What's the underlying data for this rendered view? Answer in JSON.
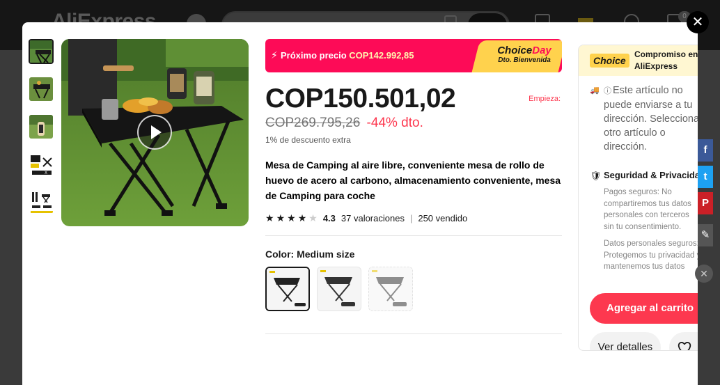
{
  "site": {
    "logo": "AliExpress",
    "cart_count": "0"
  },
  "promo": {
    "label": "Próximo precio",
    "next_price": "COP142.992,85",
    "tag_line1_a": "Choice",
    "tag_line1_b": "Day",
    "tag_line2": "Dto. Bienvenida"
  },
  "price": {
    "current": "COP150.501,02",
    "starts_label": "Empieza:",
    "original": "COP269.795,26",
    "discount": "-44% dto.",
    "extra": "1% de descuento extra"
  },
  "product": {
    "title": "Mesa de Camping al aire libre, conveniente mesa de rollo de huevo de acero al carbono, almacenamiento conveniente, mesa de Camping para coche",
    "rating": "4.3",
    "ratings_count": "37 valoraciones",
    "separator": "|",
    "sold": "250 vendido",
    "stars_value": 4.3
  },
  "color": {
    "label": "Color:",
    "selected": "Medium size",
    "options_count": 3
  },
  "side": {
    "choice_pill": "Choice",
    "commit_title": "Compromiso en AliExpress",
    "ship_text": "Este artículo no puede enviarse a tu dirección. Selecciona otro artículo o dirección.",
    "security_title": "Seguridad & Privacidad",
    "security_text1": "Pagos seguros: No compartiremos tus datos personales con terceros sin tu consentimiento.",
    "security_text2": "Datos personales seguros: Protegemos tu privacidad y mantenemos tus datos",
    "add_to_cart": "Agregar al carrito",
    "details": "Ver detalles"
  },
  "share": {
    "fb": "f",
    "tw": "t",
    "pin": "P",
    "close": "✕"
  },
  "close": "✕",
  "colors": {
    "accent_red": "#fd384f",
    "promo_pink": "#fd0b57",
    "choice_yellow": "#ffd24d"
  }
}
